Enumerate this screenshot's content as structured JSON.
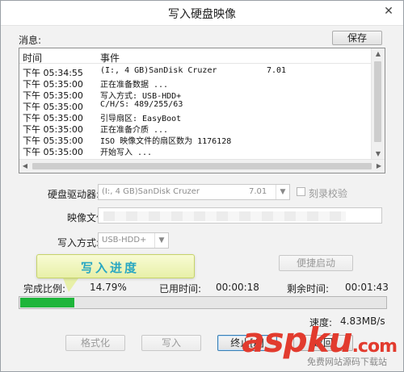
{
  "window": {
    "title": "写入硬盘映像",
    "close_icon": "close-icon"
  },
  "log": {
    "label": "消息:",
    "save_button": "保存",
    "columns": [
      "时间",
      "事件"
    ],
    "rows": [
      {
        "time": "下午 05:34:55",
        "event": "(I:, 4 GB)SanDisk Cruzer",
        "extra": "7.01"
      },
      {
        "time": "下午 05:35:00",
        "event": "正在准备数据 ...",
        "extra": ""
      },
      {
        "time": "下午 05:35:00",
        "event": "写入方式: USB-HDD+",
        "extra": ""
      },
      {
        "time": "下午 05:35:00",
        "event": "C/H/S: 489/255/63",
        "extra": ""
      },
      {
        "time": "下午 05:35:00",
        "event": "引导扇区: EasyBoot",
        "extra": ""
      },
      {
        "time": "下午 05:35:00",
        "event": "正在准备介质 ...",
        "extra": ""
      },
      {
        "time": "下午 05:35:00",
        "event": "ISO 映像文件的扇区数为 1176128",
        "extra": ""
      },
      {
        "time": "下午 05:35:00",
        "event": "开始写入 ...",
        "extra": ""
      }
    ]
  },
  "drive": {
    "label": "硬盘驱动器:",
    "value": "(I:, 4 GB)SanDisk Cruzer",
    "version": "7.01",
    "verify_label": "刻录校验"
  },
  "image_file": {
    "label": "映像文件:"
  },
  "write_mode": {
    "label": "写入方式:",
    "value": "USB-HDD+"
  },
  "callout": {
    "text": "写入进度"
  },
  "quick_boot_button": "便捷启动",
  "progress": {
    "percent_label": "完成比例:",
    "percent_value": "14.79%",
    "percent_fraction": 0.1479,
    "elapsed_label": "已用时间:",
    "elapsed_value": "00:00:18",
    "remaining_label": "剩余时间:",
    "remaining_value": "00:01:43",
    "speed_label": "速度:",
    "speed_value": "4.83MB/s"
  },
  "buttons": {
    "format": "格式化",
    "write": "写入",
    "stop": "终止[A]",
    "back": "返回"
  },
  "watermark": {
    "brand": "aspku",
    "tld": ".com",
    "sub": "免费网站源码下载站"
  },
  "colors": {
    "progress_green": "#1eb53a",
    "callout_text": "#2aa7c2",
    "watermark_red": "#e23b2e"
  }
}
